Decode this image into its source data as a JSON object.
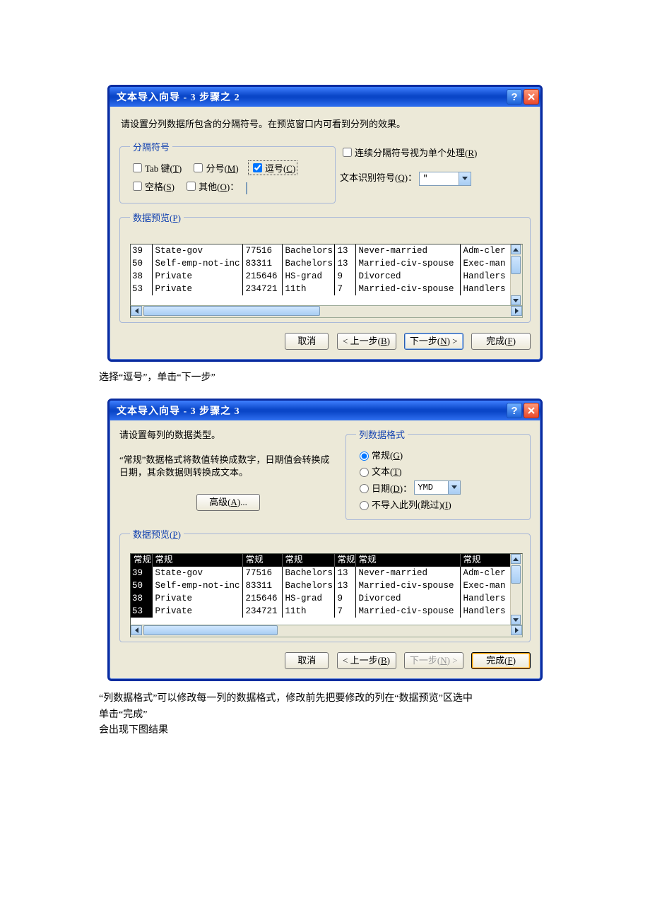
{
  "dialog2": {
    "title": "文本导入向导 - 3 步骤之 2",
    "instruction": "请设置分列数据所包含的分隔符号。在预览窗口内可看到分列的效果。",
    "delimiters_legend": "分隔符号",
    "tab_label_pre": "Tab 键(",
    "tab_label_u": "T",
    "tab_label_post": ")",
    "semicolon_pre": "分号(",
    "semicolon_u": "M",
    "semicolon_post": ")",
    "comma_pre": "逗号(",
    "comma_u": "C",
    "comma_post": ")",
    "space_pre": "空格(",
    "space_u": "S",
    "space_post": ")",
    "other_pre": "其他(",
    "other_u": "O",
    "other_post": ")：",
    "treat_consec_pre": "连续分隔符号视为单个处理(",
    "treat_consec_u": "R",
    "treat_consec_post": ")",
    "text_qualifier_pre": "文本识别符号(",
    "text_qualifier_u": "Q",
    "text_qualifier_post": ")：",
    "text_qualifier_value": "\"",
    "preview_legend_pre": "数据预览(",
    "preview_legend_u": "P",
    "preview_legend_post": ")",
    "btn_cancel": "取消",
    "btn_back_pre": "< 上一步(",
    "btn_back_u": "B",
    "btn_back_post": ")",
    "btn_next_pre": "下一步(",
    "btn_next_u": "N",
    "btn_next_post": ") >",
    "btn_finish_pre": "完成(",
    "btn_finish_u": "F",
    "btn_finish_post": ")"
  },
  "caption_after_step2": "选择“逗号”，单击“下一步”",
  "chart_data": {
    "type": "table",
    "headers": [
      "常规",
      "常规",
      "常规",
      "常规",
      "常规",
      "常规",
      "常规"
    ],
    "rows": [
      [
        "39",
        "State-gov",
        "77516",
        "Bachelors",
        "13",
        "Never-married",
        "Adm-cler"
      ],
      [
        "50",
        "Self-emp-not-inc",
        "83311",
        "Bachelors",
        "13",
        "Married-civ-spouse",
        "Exec-man"
      ],
      [
        "38",
        "Private",
        "215646",
        "HS-grad",
        "9",
        "Divorced",
        "Handlers"
      ],
      [
        "53",
        "Private",
        "234721",
        "11th",
        "7",
        "Married-civ-spouse",
        "Handlers"
      ]
    ]
  },
  "dialog3": {
    "title": "文本导入向导 - 3 步骤之 3",
    "instruction": "请设置每列的数据类型。",
    "note": "“常规”数据格式将数值转换成数字，日期值会转换成日期，其余数据则转换成文本。",
    "advanced_pre": "高级(",
    "advanced_u": "A",
    "advanced_post": ")...",
    "colformat_legend": "列数据格式",
    "fmt_general_pre": "常规(",
    "fmt_general_u": "G",
    "fmt_general_post": ")",
    "fmt_text_pre": "文本(",
    "fmt_text_u": "T",
    "fmt_text_post": ")",
    "fmt_date_pre": "日期(",
    "fmt_date_u": "D",
    "fmt_date_post": ")：",
    "date_format": "YMD",
    "fmt_skip_pre": "不导入此列(跳过)(",
    "fmt_skip_u": "I",
    "fmt_skip_post": ")",
    "preview_legend_pre": "数据预览(",
    "preview_legend_u": "P",
    "preview_legend_post": ")",
    "btn_cancel": "取消",
    "btn_back_pre": "< 上一步(",
    "btn_back_u": "B",
    "btn_back_post": ")",
    "btn_next_pre": "下一步(",
    "btn_next_u": "N",
    "btn_next_post": ") >",
    "btn_finish_pre": "完成(",
    "btn_finish_u": "F",
    "btn_finish_post": ")"
  },
  "footer_line1": "“列数据格式”可以修改每一列的数据格式，修改前先把要修改的列在“数据预览”区选中",
  "footer_line2": "单击“完成”",
  "footer_line3": "会出现下图结果"
}
